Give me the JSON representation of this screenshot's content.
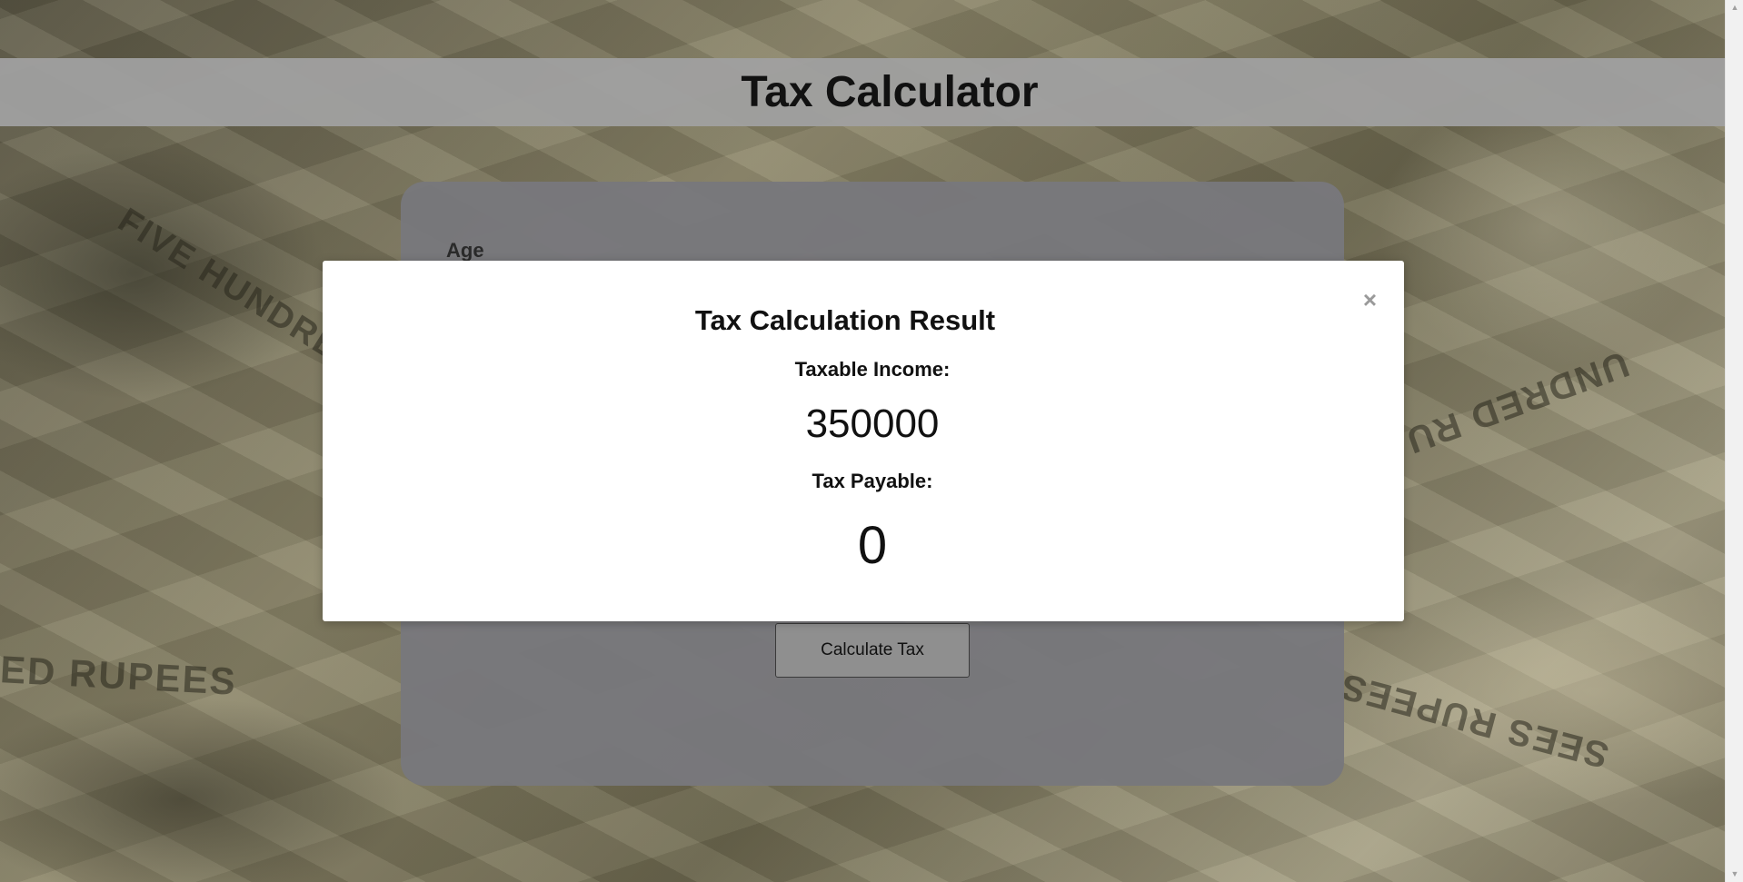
{
  "header": {
    "title": "Tax Calculator"
  },
  "form": {
    "age_label": "Age",
    "calculate_button_label": "Calculate Tax"
  },
  "modal": {
    "title": "Tax Calculation Result",
    "close_symbol": "×",
    "taxable_income_label": "Taxable Income:",
    "taxable_income_value": "350000",
    "tax_payable_label": "Tax Payable:",
    "tax_payable_value": "0"
  },
  "background": {
    "note_texts": [
      "FIVE HUNDRED",
      "ED RUPEES",
      "SEES RUPEES",
      "UNDRED RU",
      "RED RUPEES"
    ]
  },
  "scrollbar": {
    "up_arrow": "▲",
    "down_arrow": "▼"
  },
  "colors": {
    "header_bg": "#a0a0a0",
    "card_bg": "#78787c",
    "modal_bg": "#ffffff",
    "button_bg": "#8f8f8f"
  }
}
